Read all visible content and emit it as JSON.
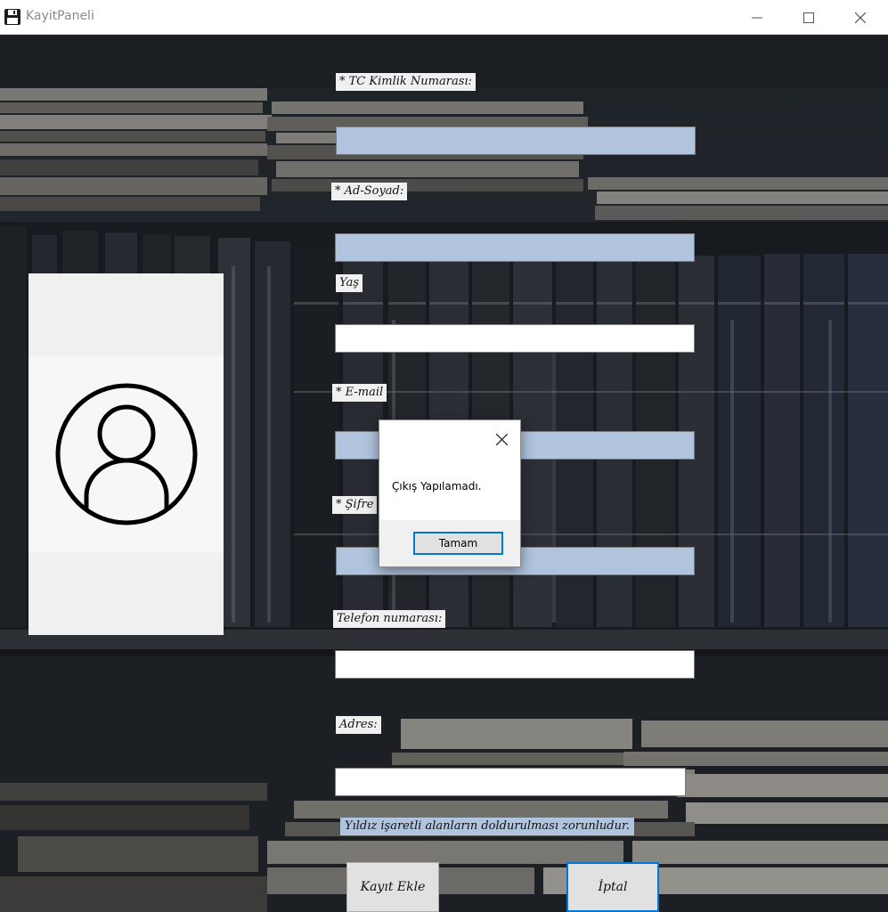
{
  "window": {
    "title": "KayitPaneli",
    "icon": "floppy-disk-icon",
    "controls": [
      "minimize-icon",
      "maximize-icon",
      "close-icon"
    ]
  },
  "form": {
    "tc_label": "* TC Kimlik Numarası:",
    "tc_value": "",
    "adsoyad_label": "* Ad-Soyad:",
    "adsoyad_value": "",
    "yas_label": "Yaş",
    "yas_value": "",
    "email_label": "* E-mail",
    "email_value": "",
    "sifre_label": "* Şifre",
    "sifre_value": "",
    "telefon_label": "Telefon numarası:",
    "telefon_value": "",
    "adres_label": "Adres:",
    "adres_value": "",
    "required_note": "Yıldız işaretli alanların doldurulması zorunludur."
  },
  "buttons": {
    "save_label": "Kayıt Ekle",
    "cancel_label": "İptal"
  },
  "dialog": {
    "message": "Çıkış Yapılamadı.",
    "ok_label": "Tamam"
  },
  "colors": {
    "required_field": "#b0c4de",
    "optional_field": "#ffffff",
    "focus_accent": "#0078d7"
  },
  "profile": {
    "icon": "user-avatar-icon"
  }
}
